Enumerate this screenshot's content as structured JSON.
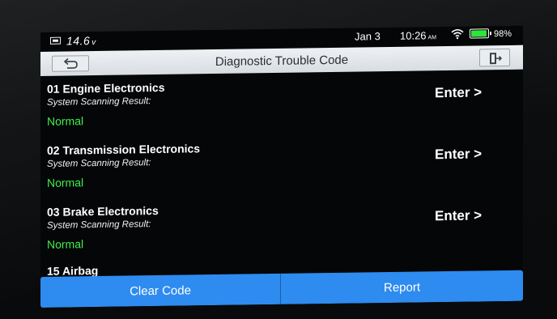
{
  "status": {
    "voltage": "14.6",
    "voltage_unit": "v",
    "date": "Jan 3",
    "time": "10:26",
    "ampm": "AM",
    "battery_pct": "98%",
    "battery_level": 0.98,
    "battery_color": "#2ee53a",
    "icons": [
      "car-battery-icon",
      "wifi-icon",
      "battery-icon"
    ]
  },
  "header": {
    "title": "Diagnostic Trouble Code",
    "back_icon": "back-arrow-icon",
    "exit_icon": "exit-icon"
  },
  "items": [
    {
      "title": "01 Engine Electronics",
      "subtitle": "System Scanning Result:",
      "status": "Normal",
      "action": "Enter >"
    },
    {
      "title": "02 Transmission Electronics",
      "subtitle": "System Scanning Result:",
      "status": "Normal",
      "action": "Enter >"
    },
    {
      "title": "03 Brake Electronics",
      "subtitle": "System Scanning Result:",
      "status": "Normal",
      "action": "Enter >"
    }
  ],
  "partial_item": "15 Airbag",
  "footer": {
    "clear_label": "Clear Code",
    "report_label": "Report",
    "accent": "#2e8bf0"
  },
  "colors": {
    "status_normal": "#3ff04a",
    "background": "#050607"
  }
}
